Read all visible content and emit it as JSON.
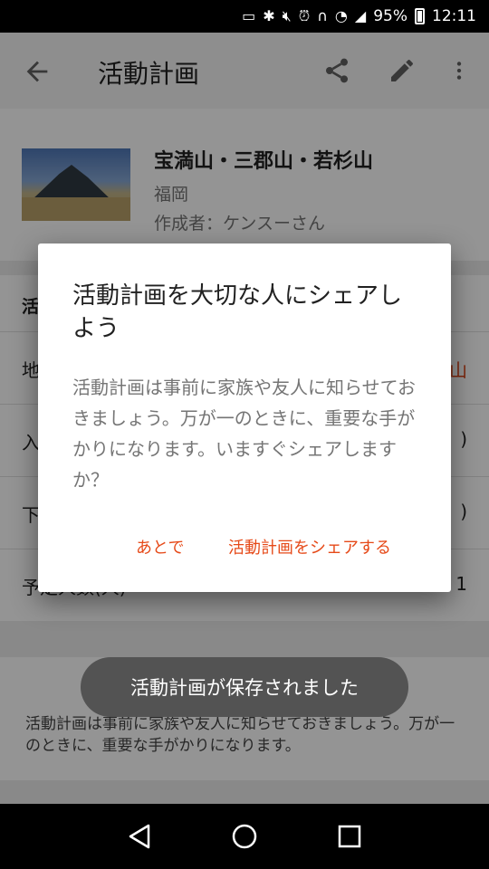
{
  "status_bar": {
    "battery": "95%",
    "time": "12:11"
  },
  "app_bar": {
    "title": "活動計画"
  },
  "summary": {
    "mountain": "宝満山・三郡山・若杉山",
    "region": "福岡",
    "author": "作成者：ケンスーさん"
  },
  "section": {
    "heading": "活"
  },
  "rows": [
    {
      "label": "地",
      "value": "山"
    },
    {
      "label": "入",
      "value": ")"
    },
    {
      "label": "下",
      "value": ")"
    },
    {
      "label": "予定人数(人)",
      "value": "1"
    }
  ],
  "note": {
    "text": "活動計画は事前に家族や友人に知らせておきましょう。万が一のときに、重要な手がかりになります。"
  },
  "dialog": {
    "title": "活動計画を大切な人にシェアしよう",
    "body": "活動計画は事前に家族や友人に知らせておきましょう。万が一のときに、重要な手がかりになります。いますぐシェアしますか？",
    "later_label": "あとで",
    "share_label": "活動計画をシェアする"
  },
  "toast": {
    "text": "活動計画が保存されました"
  },
  "colors": {
    "accent": "#e64a19",
    "toast_bg": "#535353"
  }
}
